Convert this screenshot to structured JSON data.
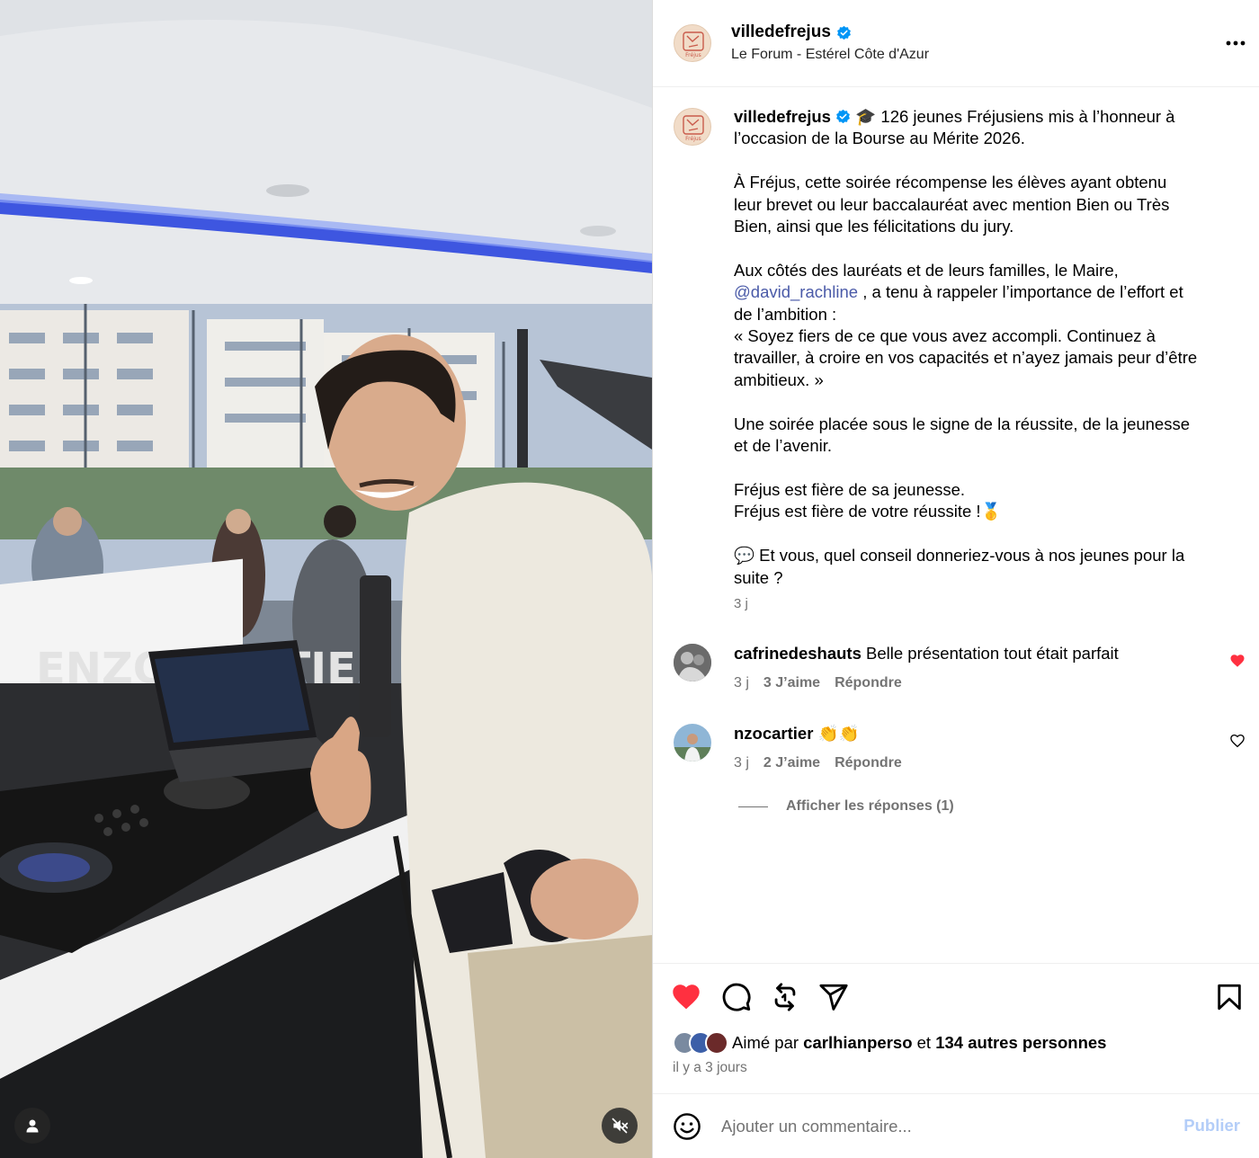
{
  "post": {
    "username": "villedefrejus",
    "location": "Le Forum - Estérel Côte d'Azur",
    "caption_lines": [
      "🎓 126 jeunes Fréjusiens mis à l’honneur à",
      "l’occasion de la Bourse au Mérite 2026.",
      "",
      "À Fréjus, cette soirée récompense les élèves ayant obtenu",
      "leur brevet ou leur baccalauréat avec mention Bien ou Très",
      "Bien, ainsi que les félicitations du jury.",
      "",
      "Aux côtés des lauréats et de leurs familles, le Maire,"
    ],
    "mention": "@david_rachline",
    "caption_after_mention_first": " , a tenu à rappeler l’importance de l’effort et",
    "caption_tail": [
      "de l’ambition :",
      "« Soyez fiers de ce que vous avez accompli. Continuez à",
      "travailler, à croire en vos capacités et n’ayez jamais peur d’être",
      "ambitieux. »",
      "",
      "Une soirée placée sous le signe de la réussite, de la jeunesse",
      "et de l’avenir.",
      "",
      "Fréjus est fière de sa jeunesse.",
      "Fréjus est fière de votre réussite !🥇",
      "",
      "💬 Et vous, quel conseil donneriez-vous à nos jeunes pour la",
      "suite ?"
    ],
    "time": "3 j",
    "avatar_text": "Fréjus"
  },
  "comments": [
    {
      "username": "cafrinedeshauts",
      "text": "Belle présentation tout était parfait",
      "time": "3 j",
      "likes": "3 J’aime",
      "reply": "Répondre",
      "liked": true
    },
    {
      "username": "nzocartier",
      "text": "👏👏",
      "time": "3 j",
      "likes": "2 J’aime",
      "reply": "Répondre",
      "liked": false
    }
  ],
  "view_replies": "Afficher les réponses (1)",
  "likes": {
    "prefix": "Aimé par",
    "user": "carlhianperso",
    "connector": "et",
    "others": "134 autres personnes"
  },
  "posted_ago": "il y a 3 jours",
  "composer": {
    "placeholder": "Ajouter un commentaire...",
    "publish": "Publier"
  },
  "media": {
    "banner_text": "ENZO CARTIER"
  },
  "colors": {
    "like_red": "#ff3040",
    "verified_blue": "#0095f6",
    "publish_disabled": "#b3cdf8",
    "mention": "#4a5aa8"
  },
  "icons": [
    "verified-icon",
    "more-icon",
    "heart-icon",
    "comment-icon",
    "repost-icon",
    "share-icon",
    "bookmark-icon",
    "emoji-icon",
    "user-tag-icon",
    "mute-icon"
  ]
}
